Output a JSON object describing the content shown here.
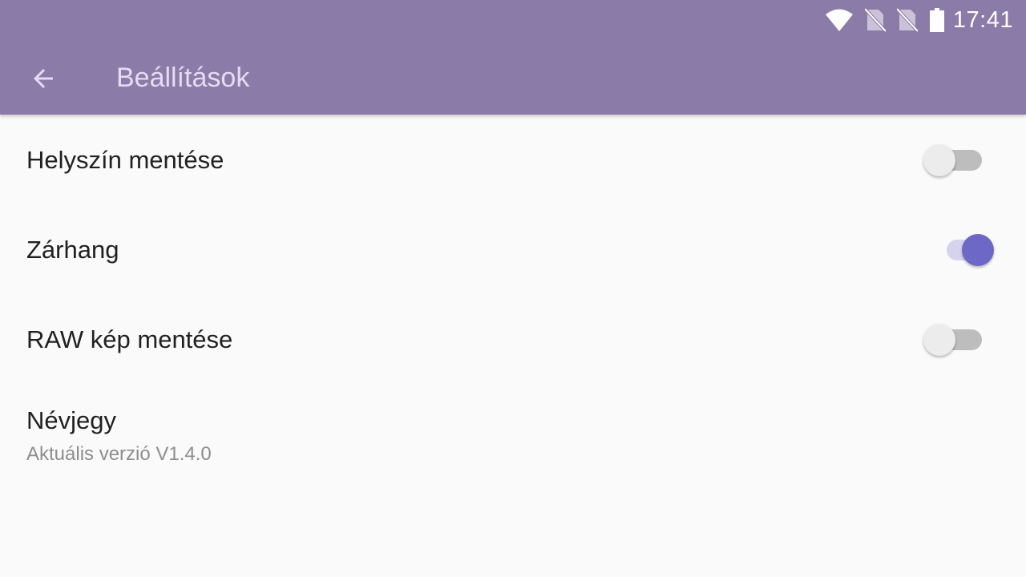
{
  "status_bar": {
    "time": "17:41",
    "icons": [
      "wifi-icon",
      "no-sim-icon",
      "no-sim-icon",
      "battery-icon"
    ]
  },
  "toolbar": {
    "back_icon": "arrow-back-icon",
    "title": "Beállítások"
  },
  "settings": [
    {
      "label": "Helyszín mentése",
      "enabled": false
    },
    {
      "label": "Zárhang",
      "enabled": true
    },
    {
      "label": "RAW kép mentése",
      "enabled": false
    }
  ],
  "about": {
    "title": "Névjegy",
    "subtitle": "Aktuális verzió V1.4.0"
  },
  "colors": {
    "app_bar": "#8b7ba8",
    "title_text": "#e4dcf0",
    "switch_on_thumb": "#6d68c6",
    "switch_on_track": "#d6d4ec",
    "switch_off_thumb": "#ececec",
    "switch_off_track": "#bdbdbd",
    "background": "#fafafa"
  }
}
